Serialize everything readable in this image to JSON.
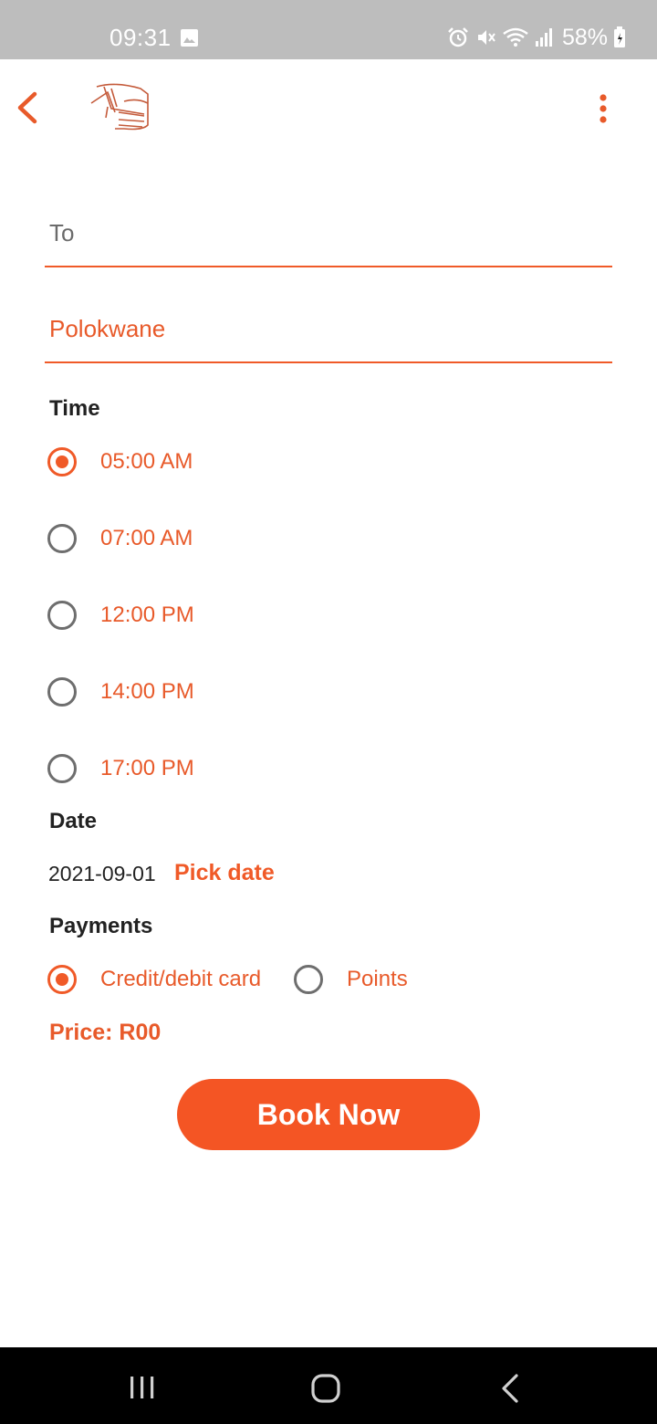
{
  "status_bar": {
    "time": "09:31",
    "battery": "58%",
    "icons": [
      "gallery-icon",
      "alarm-icon",
      "mute-icon",
      "wifi-icon",
      "signal-icon",
      "battery-icon"
    ]
  },
  "app_bar": {
    "icons": [
      "back-arrow-icon",
      "bus-logo-icon",
      "more-vert-icon"
    ]
  },
  "form": {
    "to_placeholder": "To",
    "destination_value": "Polokwane"
  },
  "time_section": {
    "label": "Time",
    "options": [
      {
        "label": "05:00 AM",
        "selected": true
      },
      {
        "label": "07:00 AM",
        "selected": false
      },
      {
        "label": "12:00 PM",
        "selected": false
      },
      {
        "label": "14:00 PM",
        "selected": false
      },
      {
        "label": "17:00 PM",
        "selected": false
      }
    ]
  },
  "date_section": {
    "label": "Date",
    "value": "2021-09-01",
    "pick_label": "Pick date"
  },
  "payments_section": {
    "label": "Payments",
    "options": [
      {
        "label": "Credit/debit card",
        "selected": true
      },
      {
        "label": "Points",
        "selected": false
      }
    ]
  },
  "price_text": "Price: R00",
  "book_button": "Book Now",
  "colors": {
    "accent": "#f05a28",
    "button": "#f45524",
    "status_bar": "#bdbdbd",
    "nav_bar": "#000000"
  }
}
